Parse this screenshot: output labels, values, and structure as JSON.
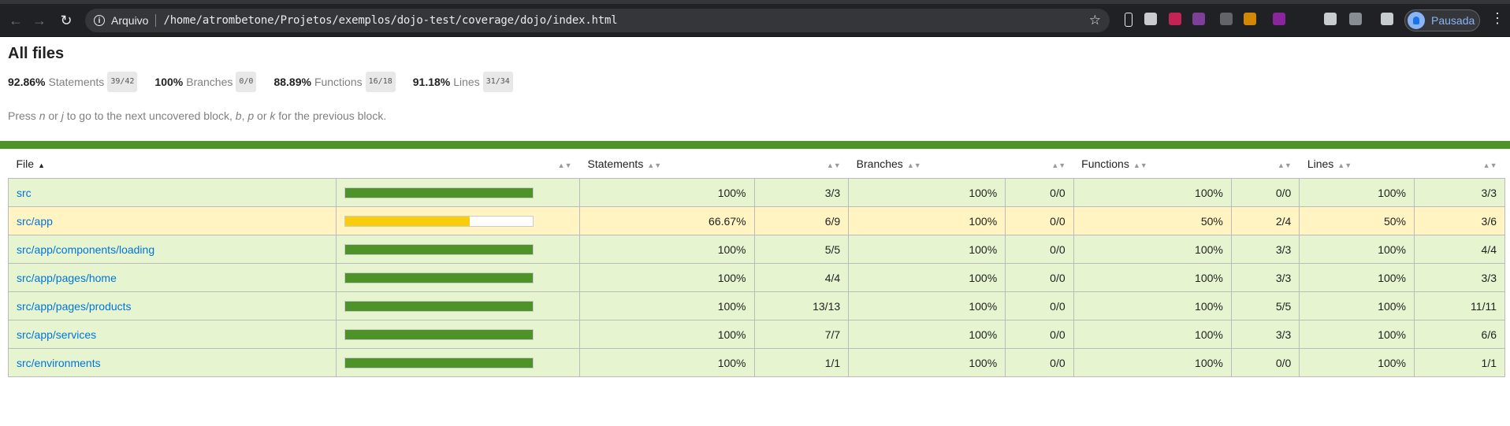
{
  "browser": {
    "scheme_label": "Arquivo",
    "url": "/home/atrombetone/Projetos/exemplos/dojo-test/coverage/dojo/index.html",
    "profile_label": "Pausada",
    "extension_icons": [
      {
        "name": "pen-extension-icon",
        "color": "#e8eaed"
      },
      {
        "name": "red-extension-icon",
        "color": "#e0245e"
      },
      {
        "name": "grid-extension-icon",
        "color": "#8e44ad"
      },
      {
        "name": "link-extension-icon",
        "color": "#6d7176"
      },
      {
        "name": "orange-extension-icon",
        "color": "#f29900"
      },
      {
        "name": "purple-extension-icon",
        "color": "#9c27b0"
      },
      {
        "name": "pdf-extension-icon",
        "color": "#e8eaed"
      },
      {
        "name": "apps-extension-icon",
        "color": "#9aa0a6"
      },
      {
        "name": "playlist-icon",
        "color": "#e8eaed"
      }
    ]
  },
  "page": {
    "title": "All files",
    "summary": [
      {
        "pct": "92.86%",
        "label": "Statements",
        "fraction": "39/42"
      },
      {
        "pct": "100%",
        "label": "Branches",
        "fraction": "0/0"
      },
      {
        "pct": "88.89%",
        "label": "Functions",
        "fraction": "16/18"
      },
      {
        "pct": "91.18%",
        "label": "Lines",
        "fraction": "31/34"
      }
    ],
    "hint": "Press n or j to go to the next uncovered block, b, p or k for the previous block.",
    "columns": {
      "file": "File",
      "statements": "Statements",
      "branches": "Branches",
      "functions": "Functions",
      "lines": "Lines"
    },
    "rows": [
      {
        "file": "src",
        "level": "high",
        "coverage": 1.0,
        "statements_pct": "100%",
        "statements": "3/3",
        "branches_pct": "100%",
        "branches": "0/0",
        "functions_pct": "100%",
        "functions": "0/0",
        "lines_pct": "100%",
        "lines": "3/3"
      },
      {
        "file": "src/app",
        "level": "medium",
        "coverage": 0.6667,
        "statements_pct": "66.67%",
        "statements": "6/9",
        "branches_pct": "100%",
        "branches": "0/0",
        "functions_pct": "50%",
        "functions": "2/4",
        "lines_pct": "50%",
        "lines": "3/6"
      },
      {
        "file": "src/app/components/loading",
        "level": "high",
        "coverage": 1.0,
        "statements_pct": "100%",
        "statements": "5/5",
        "branches_pct": "100%",
        "branches": "0/0",
        "functions_pct": "100%",
        "functions": "3/3",
        "lines_pct": "100%",
        "lines": "4/4"
      },
      {
        "file": "src/app/pages/home",
        "level": "high",
        "coverage": 1.0,
        "statements_pct": "100%",
        "statements": "4/4",
        "branches_pct": "100%",
        "branches": "0/0",
        "functions_pct": "100%",
        "functions": "3/3",
        "lines_pct": "100%",
        "lines": "3/3"
      },
      {
        "file": "src/app/pages/products",
        "level": "high",
        "coverage": 1.0,
        "statements_pct": "100%",
        "statements": "13/13",
        "branches_pct": "100%",
        "branches": "0/0",
        "functions_pct": "100%",
        "functions": "5/5",
        "lines_pct": "100%",
        "lines": "11/11"
      },
      {
        "file": "src/app/services",
        "level": "high",
        "coverage": 1.0,
        "statements_pct": "100%",
        "statements": "7/7",
        "branches_pct": "100%",
        "branches": "0/0",
        "functions_pct": "100%",
        "functions": "3/3",
        "lines_pct": "100%",
        "lines": "6/6"
      },
      {
        "file": "src/environments",
        "level": "high",
        "coverage": 1.0,
        "statements_pct": "100%",
        "statements": "1/1",
        "branches_pct": "100%",
        "branches": "0/0",
        "functions_pct": "100%",
        "functions": "0/0",
        "lines_pct": "100%",
        "lines": "1/1"
      }
    ]
  }
}
